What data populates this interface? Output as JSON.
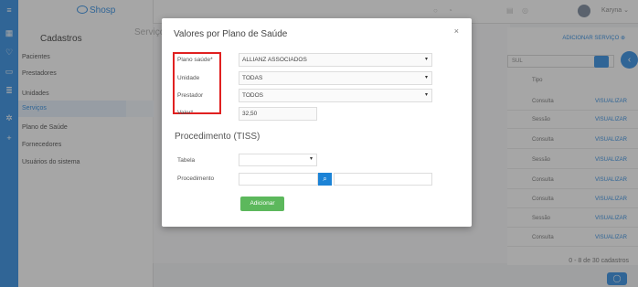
{
  "app": {
    "logo_text": "Shosp"
  },
  "rail_icons": [
    "menu-icon",
    "calendar-icon",
    "heart-icon",
    "card-icon",
    "database-icon",
    "gear-icon",
    "plus-icon"
  ],
  "sidebar": {
    "title": "Cadastros",
    "items": [
      {
        "label": "Pacientes",
        "active": false
      },
      {
        "label": "Prestadores",
        "active": false
      },
      {
        "label": "Unidades",
        "active": false
      },
      {
        "label": "Serviços",
        "active": true
      },
      {
        "label": "Plano de Saúde",
        "active": false
      },
      {
        "label": "Fornecedores",
        "active": false
      },
      {
        "label": "Usuários do sistema",
        "active": false
      }
    ]
  },
  "topbar": {
    "user_name": "Karyna"
  },
  "background": {
    "header": "Serviço",
    "add_service": "ADICIONAR SERVIÇO",
    "search_hint": "SUL",
    "tipo_header": "Tipo",
    "rows": [
      {
        "tipo": "Consulta",
        "action": "VISUALIZAR"
      },
      {
        "tipo": "Sessão",
        "action": "VISUALIZAR"
      },
      {
        "tipo": "Consulta",
        "action": "VISUALIZAR"
      },
      {
        "tipo": "Sessão",
        "action": "VISUALIZAR"
      },
      {
        "tipo": "Consulta",
        "action": "VISUALIZAR"
      },
      {
        "tipo": "Consulta",
        "action": "VISUALIZAR"
      },
      {
        "tipo": "Sessão",
        "action": "VISUALIZAR"
      },
      {
        "tipo": "Consulta",
        "action": "VISUALIZAR"
      }
    ],
    "count_text": "0 - 8 de 30 cadastros"
  },
  "modal": {
    "title": "Valores por Plano de Saúde",
    "close": "×",
    "fields": {
      "plano_label": "Plano saúde*",
      "plano_value": "ALLIANZ ASSOCIADOS",
      "unidade_label": "Unidade",
      "unidade_value": "TODAS",
      "prestador_label": "Prestador",
      "prestador_value": "TODOS",
      "valor_label": "Valor*",
      "valor_value": "32,50"
    },
    "section_title": "Procedimento (TISS)",
    "tabela_label": "Tabela",
    "procedimento_label": "Procedimento",
    "add_button": "Adicionar"
  }
}
